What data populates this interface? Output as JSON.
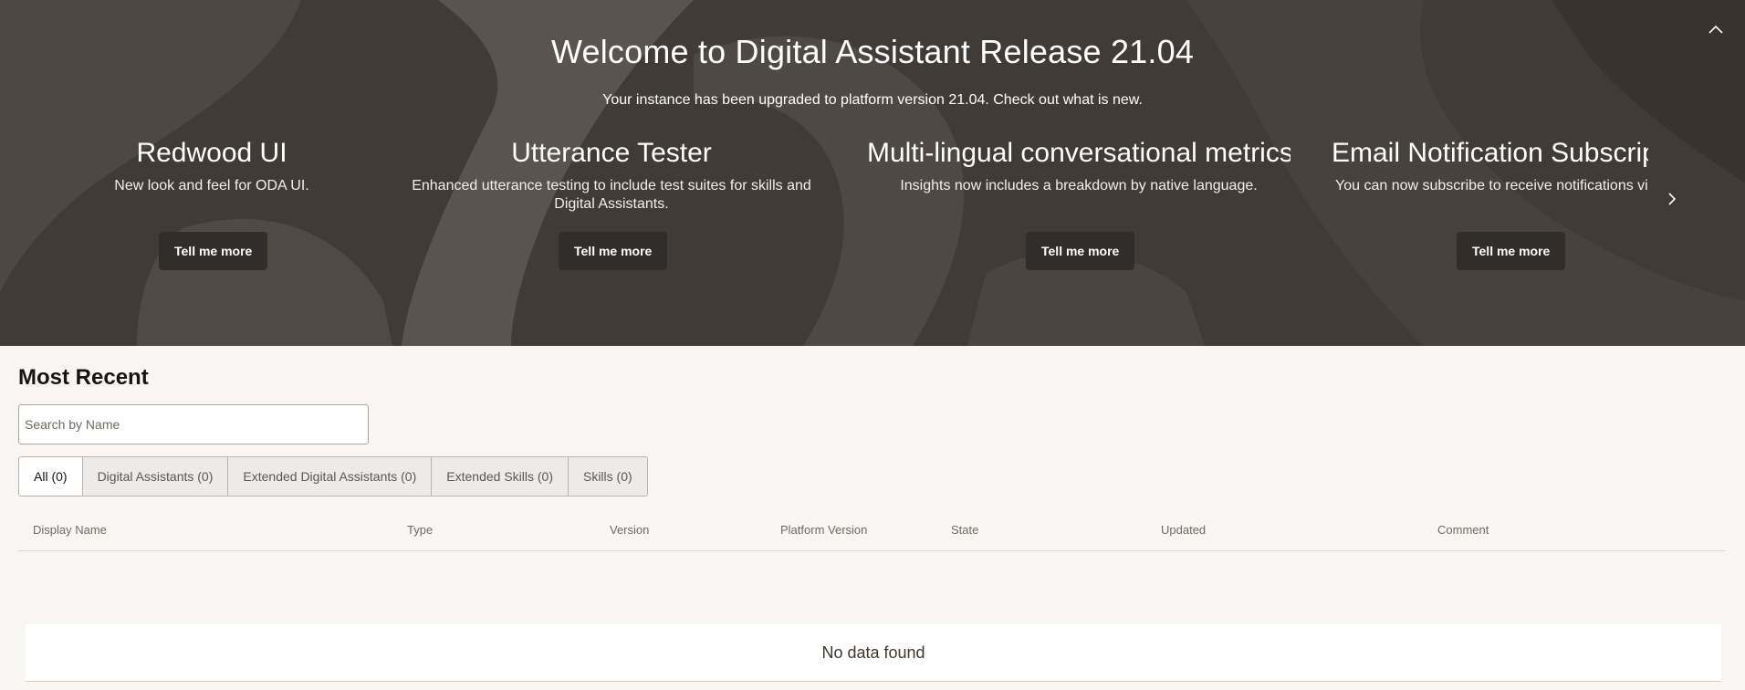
{
  "hero": {
    "title": "Welcome to Digital Assistant Release 21.04",
    "subtitle": "Your instance has been upgraded to platform version 21.04. Check out what is new.",
    "cards": [
      {
        "title": "Redwood UI",
        "description": "New look and feel for ODA UI.",
        "button": "Tell me more"
      },
      {
        "title": "Utterance Tester",
        "description": "Enhanced utterance testing to include test suites for skills and Digital Assistants.",
        "button": "Tell me more"
      },
      {
        "title": "Multi-lingual conversational metrics",
        "description": "Insights now includes a breakdown by native language.",
        "button": "Tell me more"
      },
      {
        "title": "Email Notification Subscripti",
        "description": "You can now subscribe to receive notifications via",
        "button": "Tell me more"
      }
    ]
  },
  "recent": {
    "title": "Most Recent",
    "search_placeholder": "Search by Name",
    "tabs": [
      {
        "label": "All (0)",
        "selected": true
      },
      {
        "label": "Digital Assistants (0)"
      },
      {
        "label": "Extended Digital Assistants (0)"
      },
      {
        "label": "Extended Skills (0)"
      },
      {
        "label": "Skills (0)"
      }
    ],
    "columns": [
      "Display Name",
      "Type",
      "Version",
      "Platform Version",
      "State",
      "Updated",
      "Comment"
    ],
    "empty_message": "No data found"
  },
  "icons": {
    "collapse": "chevron-up-icon",
    "next": "chevron-right-icon"
  },
  "colors": {
    "hero_bg": "#413c38",
    "button_bg": "#312d2a",
    "page_bg": "#f8f6f3"
  }
}
